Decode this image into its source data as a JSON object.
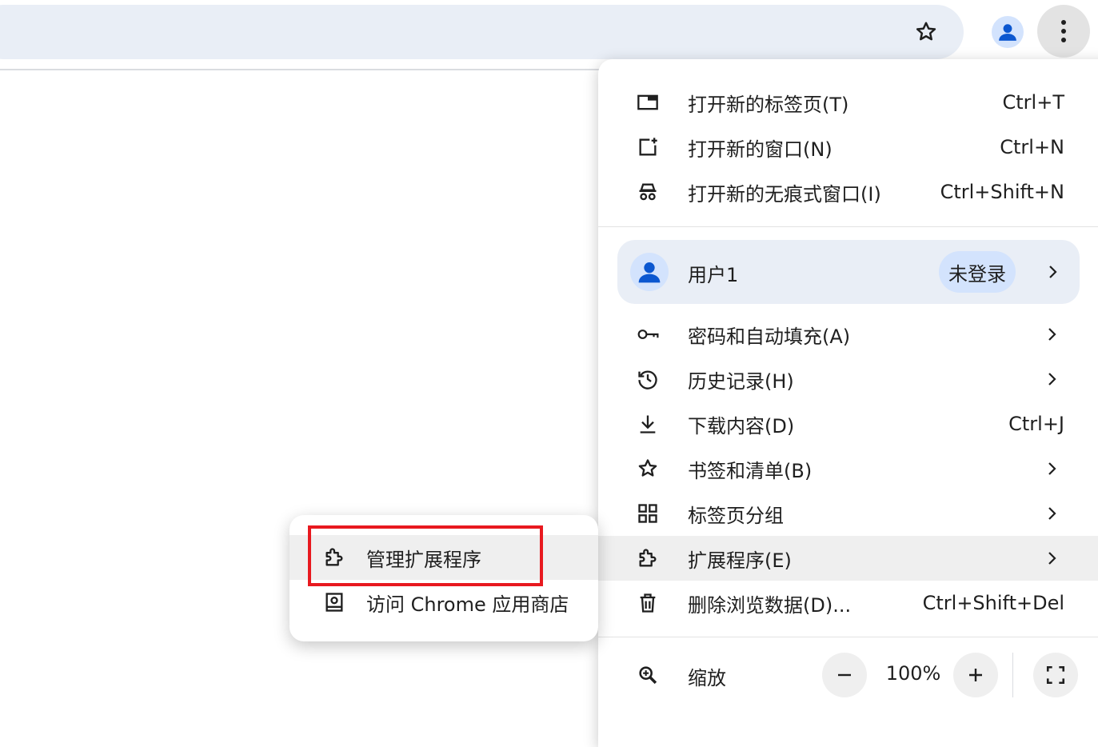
{
  "menu": {
    "items_top": [
      {
        "label": "打开新的标签页(T)",
        "shortcut": "Ctrl+T",
        "icon": "new-tab-icon"
      },
      {
        "label": "打开新的窗口(N)",
        "shortcut": "Ctrl+N",
        "icon": "new-window-icon"
      },
      {
        "label": "打开新的无痕式窗口(I)",
        "shortcut": "Ctrl+Shift+N",
        "icon": "incognito-icon"
      }
    ],
    "profile": {
      "name": "用户1",
      "status": "未登录"
    },
    "items_mid": [
      {
        "label": "密码和自动填充(A)",
        "icon": "key-icon"
      },
      {
        "label": "历史记录(H)",
        "icon": "history-icon"
      },
      {
        "label": "下载内容(D)",
        "shortcut": "Ctrl+J",
        "icon": "download-icon"
      },
      {
        "label": "书签和清单(B)",
        "icon": "star-icon"
      },
      {
        "label": "标签页分组",
        "icon": "tab-groups-icon"
      },
      {
        "label": "扩展程序(E)",
        "icon": "extension-icon"
      },
      {
        "label": "删除浏览数据(D)...",
        "shortcut": "Ctrl+Shift+Del",
        "icon": "trash-icon"
      }
    ],
    "zoom": {
      "label": "缩放",
      "minus": "−",
      "value": "100%",
      "plus": "+"
    }
  },
  "submenu": {
    "items": [
      {
        "label": "管理扩展程序",
        "icon": "extension-icon"
      },
      {
        "label": "访问 Chrome 应用商店",
        "icon": "store-icon"
      }
    ]
  },
  "colors": {
    "highlight": "#e8191f",
    "accent": "#0b57d0",
    "profile_bg": "#e9eef6",
    "badge_bg": "#d3e3fd"
  }
}
